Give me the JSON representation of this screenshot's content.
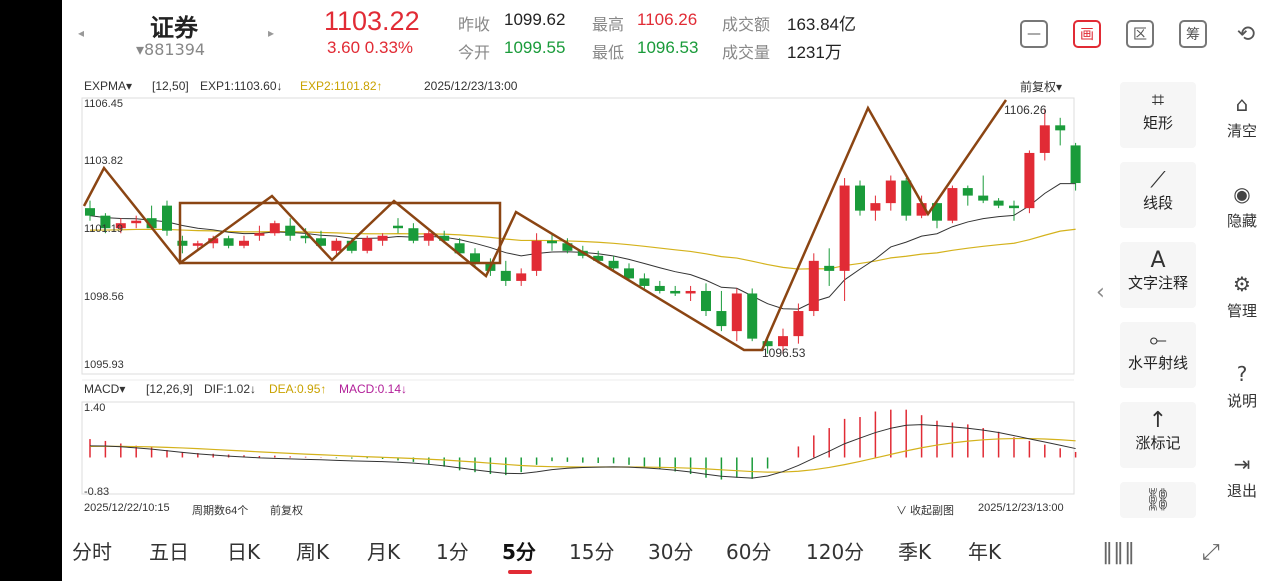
{
  "header": {
    "prev_arrow": "◂",
    "next_arrow": "▸",
    "title": "证券",
    "code": "▾881394",
    "price": "1103.22",
    "change": "3.60  0.33%",
    "stats": [
      {
        "label": "昨收",
        "value": "1099.62",
        "color": "dark"
      },
      {
        "label": "最高",
        "value": "1106.26",
        "color": "red"
      },
      {
        "label": "成交额",
        "value": "163.84亿",
        "color": "dark"
      },
      {
        "label": "今开",
        "value": "1099.55",
        "color": "green"
      },
      {
        "label": "最低",
        "value": "1096.53",
        "color": "green"
      },
      {
        "label": "成交量",
        "value": "1231万",
        "color": "dark"
      }
    ],
    "buttons": [
      "—",
      "画",
      "区",
      "筹"
    ],
    "rotate_icon": "rotate-icon"
  },
  "chart": {
    "indicator": "EXPMA▾",
    "params": "[12,50]",
    "exp1": "EXP1:1103.60↓",
    "exp2": "EXP2:1101.82↑",
    "timestamp": "2025/12/23/13:00",
    "adjust": "前复权▾",
    "y_labels": [
      "1106.45",
      "1103.82",
      "1101.19",
      "1098.56",
      "1095.93"
    ],
    "high_label": "1106.26",
    "low_label": "1096.53",
    "macd_label": "MACD▾",
    "macd_params": "[12,26,9]",
    "dif": "DIF:1.02↓",
    "dea": "DEA:0.95↑",
    "macd": "MACD:0.14↓",
    "macd_top": "1.40",
    "macd_bottom": "-0.83",
    "start_date": "2025/12/22/10:15",
    "period_count": "周期数64个",
    "adjust_small": "前复权",
    "collapse": "∨ 收起副图",
    "end_date": "2025/12/23/13:00",
    "colors": {
      "up": "#e12b35",
      "down": "#1a9b3a",
      "exp1": "#333333",
      "exp2": "#d4b21c",
      "draw": "#8b4513"
    }
  },
  "tools": [
    {
      "icon": "rectangle-icon",
      "glyph": "⌗",
      "label": "矩形"
    },
    {
      "icon": "segment-icon",
      "glyph": "⟋",
      "label": "线段"
    },
    {
      "icon": "text-icon",
      "glyph": "A",
      "label": "文字注释"
    },
    {
      "icon": "ray-icon",
      "glyph": "⟜",
      "label": "水平射线"
    },
    {
      "icon": "arrow-up-icon",
      "glyph": "↑",
      "label": "涨标记"
    },
    {
      "icon": "more-icon",
      "glyph": "⛓",
      "label": ""
    }
  ],
  "side": [
    {
      "icon": "trash-icon",
      "glyph": "🗑",
      "label": "清空"
    },
    {
      "icon": "eye-icon",
      "glyph": "◉",
      "label": "隐藏"
    },
    {
      "icon": "gear-icon",
      "glyph": "⚙",
      "label": "管理"
    },
    {
      "icon": "help-icon",
      "glyph": "?",
      "label": "说明"
    },
    {
      "icon": "exit-icon",
      "glyph": "⇥",
      "label": "退出"
    }
  ],
  "chevron": "‹",
  "tabs": [
    "分时",
    "五日",
    "日K",
    "周K",
    "月K",
    "1分",
    "5分",
    "15分",
    "30分",
    "60分",
    "120分",
    "季K",
    "年K"
  ],
  "active_tab": "5分",
  "candles": [
    [
      1102.3,
      1102.6,
      1101.8,
      1102.0
    ],
    [
      1102.0,
      1102.1,
      1101.3,
      1101.5
    ],
    [
      1101.5,
      1101.9,
      1101.3,
      1101.7
    ],
    [
      1101.7,
      1102.0,
      1101.5,
      1101.8
    ],
    [
      1101.9,
      1102.4,
      1101.6,
      1101.5
    ],
    [
      1102.4,
      1102.6,
      1101.2,
      1101.4
    ],
    [
      1101.0,
      1101.2,
      1100.5,
      1100.8
    ],
    [
      1100.8,
      1101.0,
      1100.6,
      1100.9
    ],
    [
      1100.9,
      1101.2,
      1100.7,
      1101.1
    ],
    [
      1101.1,
      1101.2,
      1100.7,
      1100.8
    ],
    [
      1100.8,
      1101.2,
      1100.7,
      1101.0
    ],
    [
      1101.2,
      1101.6,
      1101.0,
      1101.3
    ],
    [
      1101.3,
      1101.8,
      1101.2,
      1101.7
    ],
    [
      1101.6,
      1101.9,
      1101.0,
      1101.2
    ],
    [
      1101.2,
      1101.5,
      1100.9,
      1101.1
    ],
    [
      1101.1,
      1101.4,
      1100.7,
      1100.8
    ],
    [
      1100.6,
      1101.1,
      1100.4,
      1101.0
    ],
    [
      1101.0,
      1101.1,
      1100.5,
      1100.6
    ],
    [
      1100.6,
      1101.2,
      1100.5,
      1101.1
    ],
    [
      1101.0,
      1101.3,
      1100.8,
      1101.2
    ],
    [
      1101.6,
      1101.9,
      1101.3,
      1101.5
    ],
    [
      1101.5,
      1101.7,
      1100.9,
      1101.0
    ],
    [
      1101.0,
      1101.4,
      1100.8,
      1101.3
    ],
    [
      1101.2,
      1101.4,
      1100.9,
      1101.0
    ],
    [
      1100.9,
      1101.1,
      1100.4,
      1100.5
    ],
    [
      1100.5,
      1100.7,
      1100.0,
      1100.1
    ],
    [
      1100.1,
      1100.3,
      1099.6,
      1099.8
    ],
    [
      1099.8,
      1100.2,
      1099.2,
      1099.4
    ],
    [
      1099.4,
      1099.9,
      1099.2,
      1099.7
    ],
    [
      1099.8,
      1101.3,
      1099.6,
      1101.0
    ],
    [
      1101.0,
      1101.3,
      1100.6,
      1100.9
    ],
    [
      1100.9,
      1101.1,
      1100.5,
      1100.6
    ],
    [
      1100.6,
      1100.8,
      1100.3,
      1100.4
    ],
    [
      1100.4,
      1100.6,
      1100.1,
      1100.2
    ],
    [
      1100.2,
      1100.4,
      1099.8,
      1099.9
    ],
    [
      1099.9,
      1100.1,
      1099.4,
      1099.5
    ],
    [
      1099.5,
      1099.7,
      1099.1,
      1099.2
    ],
    [
      1099.2,
      1099.4,
      1098.9,
      1099.0
    ],
    [
      1099.0,
      1099.2,
      1098.8,
      1098.9
    ],
    [
      1098.9,
      1099.2,
      1098.6,
      1099.0
    ],
    [
      1099.0,
      1099.3,
      1098.0,
      1098.2
    ],
    [
      1098.2,
      1099.0,
      1097.4,
      1097.6
    ],
    [
      1097.4,
      1099.1,
      1097.0,
      1098.9
    ],
    [
      1098.9,
      1099.1,
      1097.0,
      1097.1
    ],
    [
      1097.0,
      1097.2,
      1096.5,
      1096.8
    ],
    [
      1096.8,
      1097.5,
      1096.5,
      1097.2
    ],
    [
      1097.2,
      1098.5,
      1096.9,
      1098.2
    ],
    [
      1098.2,
      1100.5,
      1098.0,
      1100.2
    ],
    [
      1100.0,
      1100.7,
      1099.2,
      1099.8
    ],
    [
      1099.8,
      1103.5,
      1098.6,
      1103.2
    ],
    [
      1103.2,
      1103.4,
      1102.0,
      1102.2
    ],
    [
      1102.2,
      1102.8,
      1101.8,
      1102.5
    ],
    [
      1102.5,
      1103.6,
      1102.2,
      1103.4
    ],
    [
      1103.4,
      1103.5,
      1101.8,
      1102.0
    ],
    [
      1102.0,
      1102.8,
      1101.9,
      1102.5
    ],
    [
      1102.5,
      1102.6,
      1101.5,
      1101.8
    ],
    [
      1101.8,
      1103.2,
      1101.7,
      1103.1
    ],
    [
      1103.1,
      1103.2,
      1102.4,
      1102.8
    ],
    [
      1102.8,
      1103.6,
      1102.5,
      1102.6
    ],
    [
      1102.6,
      1102.7,
      1102.3,
      1102.4
    ],
    [
      1102.4,
      1102.6,
      1101.8,
      1102.3
    ],
    [
      1102.3,
      1104.6,
      1102.1,
      1104.5
    ],
    [
      1104.5,
      1106.26,
      1104.2,
      1105.6
    ],
    [
      1105.6,
      1105.9,
      1104.8,
      1105.4
    ],
    [
      1104.8,
      1104.9,
      1103.0,
      1103.3
    ]
  ],
  "macd_bars": [
    0.5,
    0.45,
    0.38,
    0.32,
    0.28,
    0.2,
    0.15,
    0.12,
    0.1,
    0.08,
    0.06,
    0.04,
    0.05,
    0.03,
    0.02,
    0.01,
    -0.02,
    -0.03,
    -0.02,
    -0.04,
    -0.08,
    -0.12,
    -0.18,
    -0.25,
    -0.35,
    -0.4,
    -0.45,
    -0.48,
    -0.4,
    -0.2,
    -0.1,
    -0.12,
    -0.14,
    -0.15,
    -0.16,
    -0.2,
    -0.25,
    -0.3,
    -0.38,
    -0.45,
    -0.55,
    -0.6,
    -0.55,
    -0.58,
    -0.3,
    0.0,
    0.3,
    0.6,
    0.8,
    1.05,
    1.1,
    1.25,
    1.3,
    1.3,
    1.15,
    1.0,
    0.95,
    0.9,
    0.8,
    0.7,
    0.55,
    0.45,
    0.35,
    0.25,
    0.15
  ]
}
